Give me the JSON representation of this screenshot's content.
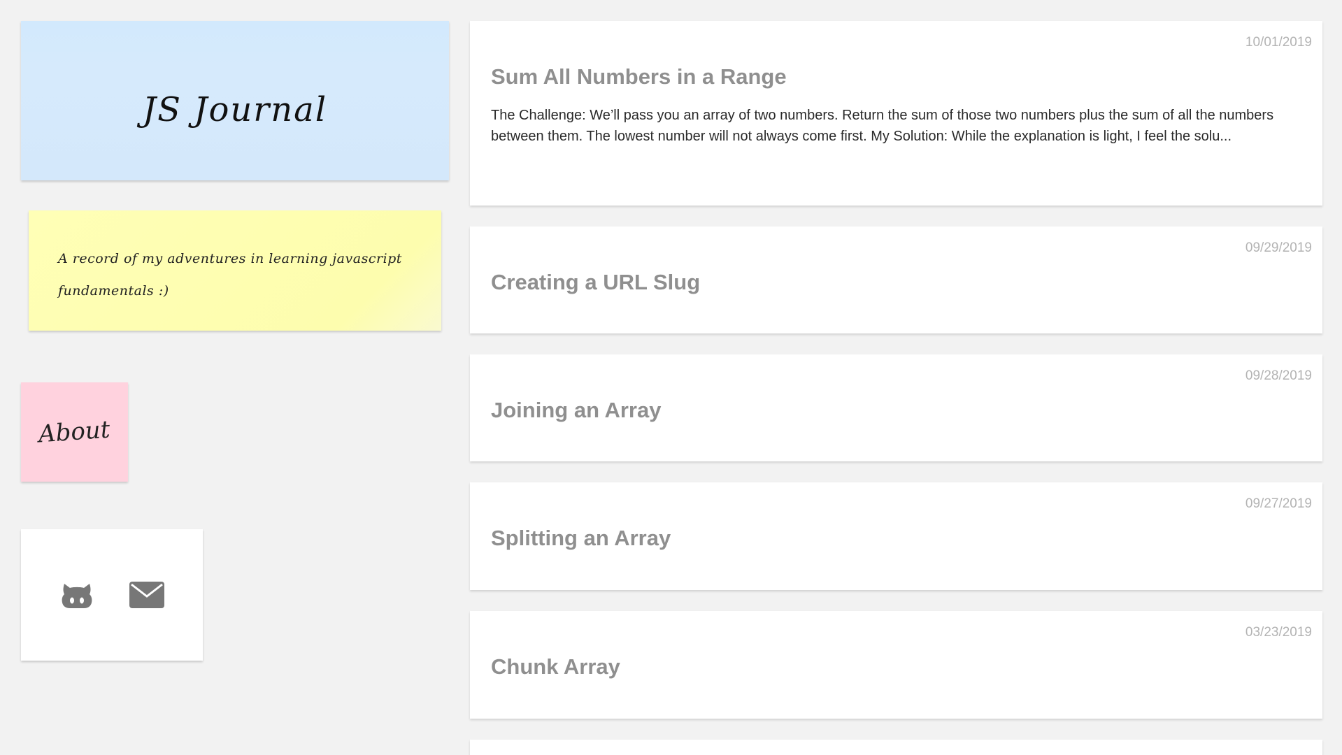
{
  "sidebar": {
    "title": "JS Journal",
    "description": "A record of my adventures in learning javascript fundamentals :)",
    "about_label": "About",
    "links": {
      "github_icon": "github-icon",
      "email_icon": "envelope-icon",
      "icon_color": "#777777"
    }
  },
  "colors": {
    "background": "#f2f2f2",
    "title_note": "#d4e8fb",
    "desc_note": "#ffffb6",
    "about_note": "#ffd2de",
    "card": "#ffffff",
    "post_title": "#8f8f8f",
    "post_date": "#b3b3b3"
  },
  "posts": [
    {
      "date": "10/01/2019",
      "title": "Sum All Numbers in a Range",
      "excerpt": "The Challenge: We’ll pass you an array of two numbers. Return the sum of those two numbers plus the sum of all the numbers between them. The lowest number will not always come first. My Solution: While the explanation is light, I feel the solu..."
    },
    {
      "date": "09/29/2019",
      "title": "Creating a URL Slug"
    },
    {
      "date": "09/28/2019",
      "title": "Joining an Array"
    },
    {
      "date": "09/27/2019",
      "title": "Splitting an Array"
    },
    {
      "date": "03/23/2019",
      "title": "Chunk Array"
    }
  ]
}
